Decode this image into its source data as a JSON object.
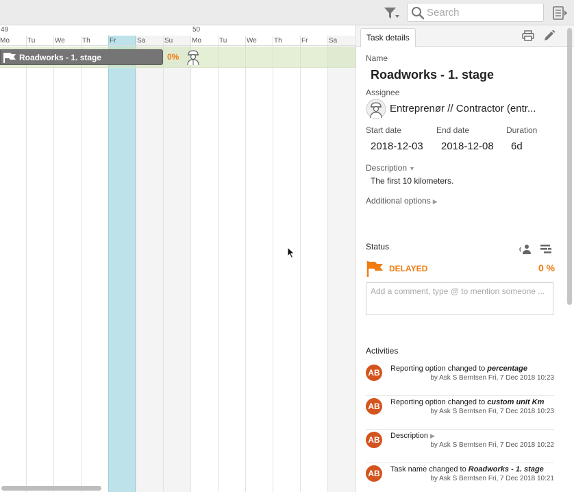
{
  "toolbar": {
    "search_placeholder": "Search",
    "filter_icon": "filter-icon",
    "panel_toggle_icon": "panel-toggle-icon"
  },
  "gantt": {
    "weeks": [
      "49",
      "50"
    ],
    "days": [
      "Mo",
      "Tu",
      "We",
      "Th",
      "Fr",
      "Sa",
      "Su",
      "Mo",
      "Tu",
      "We",
      "Th",
      "Fr",
      "Sa"
    ],
    "task": {
      "label": "Roadworks - 1. stage",
      "percent": "0%"
    }
  },
  "panel": {
    "tab_label": "Task details",
    "name_label": "Name",
    "name_value": "Roadworks - 1. stage",
    "assignee_label": "Assignee",
    "assignee_value": "Entreprenør // Contractor (entr...",
    "start_label": "Start date",
    "start_value": "2018-12-03",
    "end_label": "End date",
    "end_value": "2018-12-08",
    "duration_label": "Duration",
    "duration_value": "6d",
    "description_label": "Description",
    "description_value": "The first 10 kilometers.",
    "additional_label": "Additional options",
    "status_label": "Status",
    "status_value": "DELAYED",
    "status_percent": "0 %",
    "comment_placeholder": "Add a comment, type @ to mention someone ...",
    "activities_label": "Activities",
    "activities": [
      {
        "initials": "AB",
        "text": "Reporting option changed to ",
        "em": "percentage",
        "by": "by Ask S Berntsen Fri, 7 Dec 2018 10:23"
      },
      {
        "initials": "AB",
        "text": "Reporting option changed to ",
        "em": "custom unit Km",
        "by": "by Ask S Berntsen Fri, 7 Dec 2018 10:23"
      },
      {
        "initials": "AB",
        "text": "Description",
        "em": "",
        "by": "by Ask S Berntsen Fri, 7 Dec 2018 10:22"
      },
      {
        "initials": "AB",
        "text": "Task name changed to ",
        "em": "Roadworks - 1. stage",
        "by": "by Ask S Berntsen Fri, 7 Dec 2018 10:21"
      }
    ]
  },
  "colors": {
    "accent_orange": "#f07c12",
    "avatar_red": "#d4541f",
    "today_blue": "#bde2ea",
    "task_row_green": "#dfeccf"
  }
}
